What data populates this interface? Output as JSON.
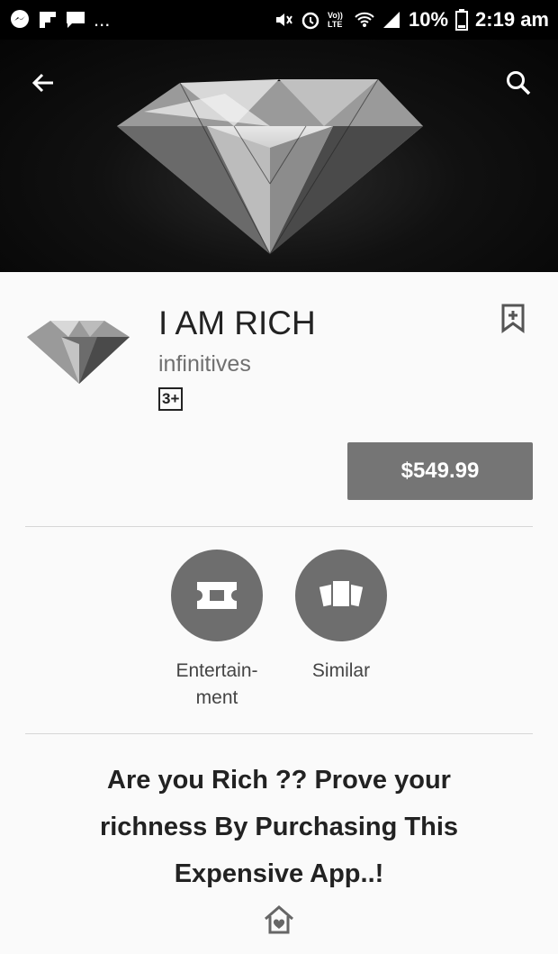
{
  "status_bar": {
    "battery": "10%",
    "time": "2:19 am",
    "network_label": "Vo)) LTE"
  },
  "app": {
    "title": "I AM RICH",
    "developer": "infinitives",
    "content_rating": "3+",
    "price": "$549.99"
  },
  "actions": {
    "category_label": "Entertain-\nment",
    "similar_label": "Similar"
  },
  "description": "Are you Rich ?? Prove your richness By Purchasing This Expensive App..!",
  "icons": [
    "messenger-icon",
    "flipboard-icon",
    "chat-icon",
    "mute-icon",
    "alarm-icon",
    "wifi-icon",
    "signal-icon",
    "battery-icon",
    "back-icon",
    "search-icon",
    "bookmark-add-icon",
    "ticket-icon",
    "cards-icon",
    "home-icon"
  ],
  "colors": {
    "price_button": "#757575",
    "circle_button": "#6e6e6e",
    "hero_background": "#0a0a0a"
  }
}
